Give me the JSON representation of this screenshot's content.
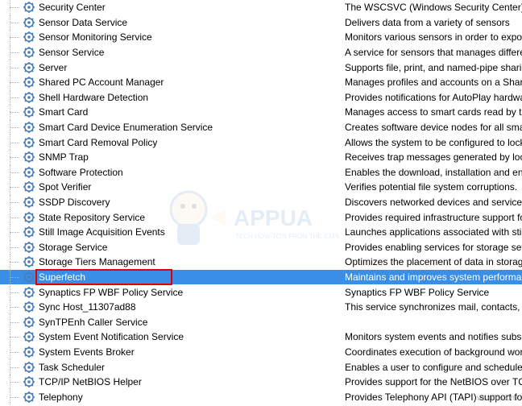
{
  "services": [
    {
      "name": "Security Center",
      "desc": "The WSCSVC (Windows Security Center) servic"
    },
    {
      "name": "Sensor Data Service",
      "desc": "Delivers data from a variety of sensors"
    },
    {
      "name": "Sensor Monitoring Service",
      "desc": "Monitors various sensors in order to expose da"
    },
    {
      "name": "Sensor Service",
      "desc": "A service for sensors that manages different se"
    },
    {
      "name": "Server",
      "desc": "Supports file, print, and named-pipe sharing o"
    },
    {
      "name": "Shared PC Account Manager",
      "desc": "Manages profiles and accounts on a SharedPC"
    },
    {
      "name": "Shell Hardware Detection",
      "desc": "Provides notifications for AutoPlay hardware e"
    },
    {
      "name": "Smart Card",
      "desc": "Manages access to smart cards read by this co"
    },
    {
      "name": "Smart Card Device Enumeration Service",
      "desc": "Creates software device nodes for all smart ca"
    },
    {
      "name": "Smart Card Removal Policy",
      "desc": "Allows the system to be configured to lock the"
    },
    {
      "name": "SNMP Trap",
      "desc": "Receives trap messages generated by local or"
    },
    {
      "name": "Software Protection",
      "desc": "Enables the download, installation and enforc"
    },
    {
      "name": "Spot Verifier",
      "desc": "Verifies potential file system corruptions."
    },
    {
      "name": "SSDP Discovery",
      "desc": "Discovers networked devices and services that"
    },
    {
      "name": "State Repository Service",
      "desc": "Provides required infrastructure support for th"
    },
    {
      "name": "Still Image Acquisition Events",
      "desc": "Launches applications associated with still ima"
    },
    {
      "name": "Storage Service",
      "desc": "Provides enabling services for storage settings"
    },
    {
      "name": "Storage Tiers Management",
      "desc": "Optimizes the placement of data in storage tie"
    },
    {
      "name": "Superfetch",
      "desc": "Maintains and improves system performance o",
      "selected": true,
      "highlighted": true
    },
    {
      "name": "Synaptics FP WBF Policy Service",
      "desc": "Synaptics FP WBF Policy Service"
    },
    {
      "name": "Sync Host_11307ad88",
      "desc": "This service synchronizes mail, contacts, calen"
    },
    {
      "name": "SynTPEnh Caller Service",
      "desc": ""
    },
    {
      "name": "System Event Notification Service",
      "desc": "Monitors system events and notifies subscribe"
    },
    {
      "name": "System Events Broker",
      "desc": "Coordinates execution of background work fo"
    },
    {
      "name": "Task Scheduler",
      "desc": "Enables a user to configure and schedule auto"
    },
    {
      "name": "TCP/IP NetBIOS Helper",
      "desc": "Provides support for the NetBIOS over TCP/IP"
    },
    {
      "name": "Telephony",
      "desc": "Provides Telephony API (TAPI) support for pro"
    }
  ],
  "watermark_text": "APPUA",
  "footer": "wsxdn.com"
}
